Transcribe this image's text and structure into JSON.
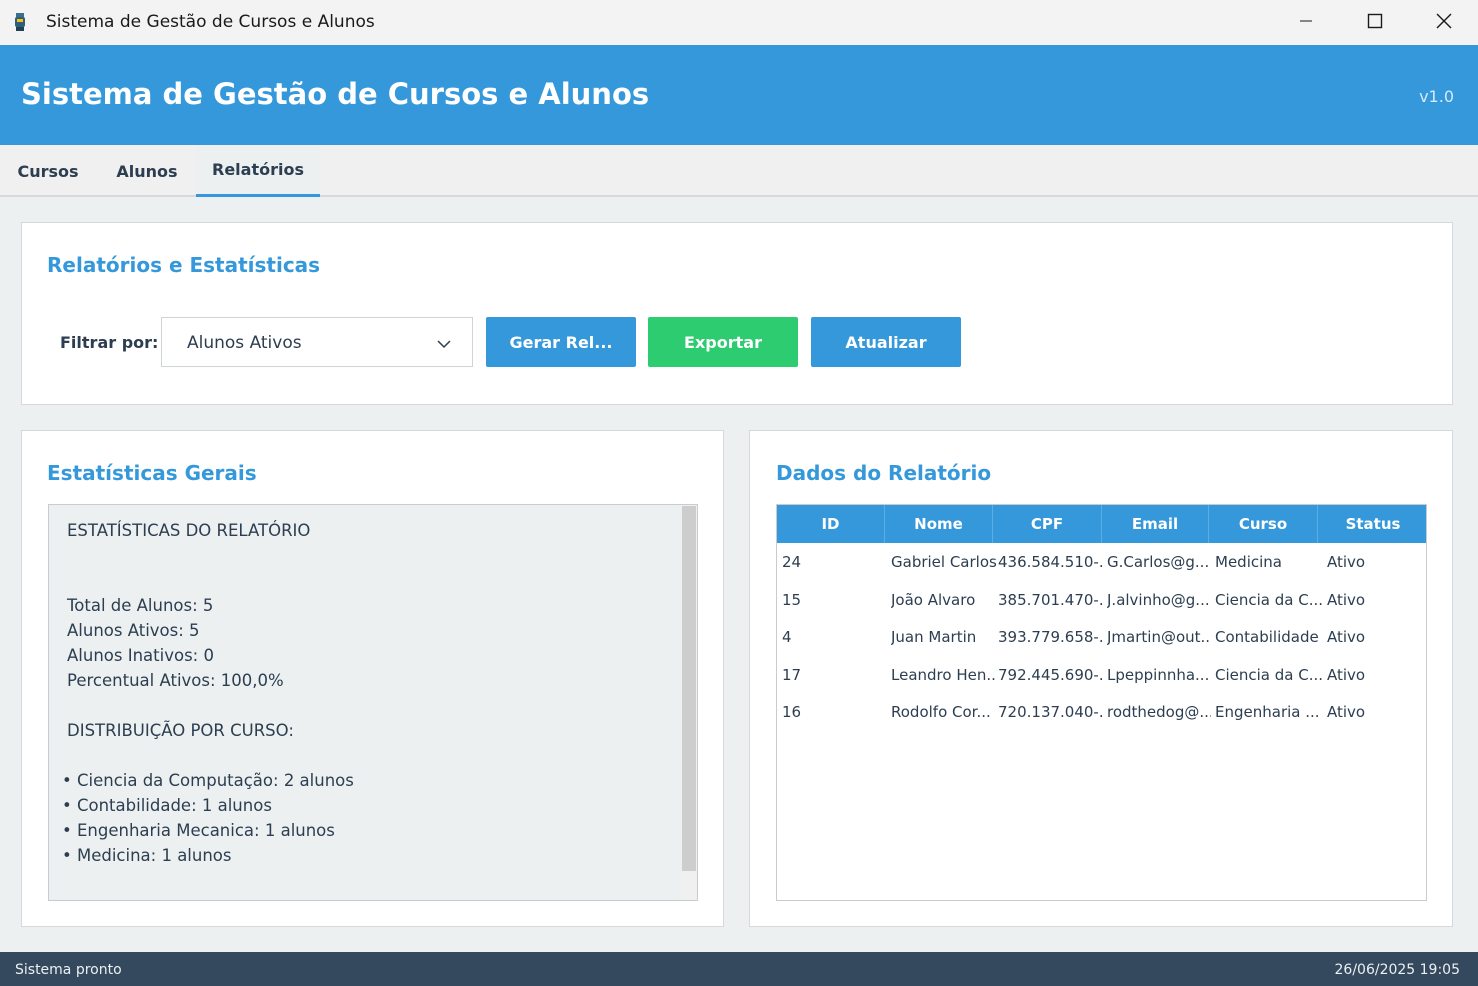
{
  "window": {
    "title": "Sistema de Gestão de Cursos e Alunos",
    "icon": "app-icon",
    "controls": [
      "minimize-icon",
      "maximize-icon",
      "close-icon"
    ]
  },
  "header": {
    "title": "Sistema de Gestão de Cursos e Alunos",
    "version": "v1.0",
    "color": "#3498db"
  },
  "tabs": [
    {
      "label": "Cursos",
      "active": false
    },
    {
      "label": "Alunos",
      "active": false
    },
    {
      "label": "Relatórios",
      "active": true
    }
  ],
  "reports": {
    "title": "Relatórios e Estatísticas",
    "filter_label": "Filtrar por:",
    "filter_value": "Alunos Ativos",
    "buttons": {
      "gerar": "Gerar Rel...",
      "exportar": "Exportar",
      "atualizar": "Atualizar"
    },
    "colors": {
      "primary": "#3498db",
      "success": "#2ecc71"
    }
  },
  "stats": {
    "title": "Estatísticas Gerais",
    "lines": [
      "ESTATÍSTICAS DO RELATÓRIO",
      "Total de Alunos: 5",
      "Alunos Ativos: 5",
      "Alunos Inativos: 0",
      "Percentual Ativos: 100,0%",
      "DISTRIBUIÇÃO POR CURSO:",
      "• Ciencia da Computação: 2 alunos",
      "• Contabilidade: 1 alunos",
      "• Engenharia Mecanica: 1 alunos",
      "• Medicina: 1 alunos"
    ]
  },
  "report_data": {
    "title": "Dados do Relatório",
    "columns": [
      "ID",
      "Nome",
      "CPF",
      "Email",
      "Curso",
      "Status"
    ],
    "rows": [
      [
        "24",
        "Gabriel Carlos",
        "436.584.510-...",
        "G.Carlos@g...",
        "Medicina",
        "Ativo"
      ],
      [
        "15",
        "João Alvaro",
        "385.701.470-...",
        "J.alvinho@g...",
        "Ciencia da C...",
        "Ativo"
      ],
      [
        "4",
        "Juan Martin",
        "393.779.658-...",
        "Jmartin@out...",
        "Contabilidade",
        "Ativo"
      ],
      [
        "17",
        "Leandro Hen...",
        "792.445.690-...",
        "Lpeppinnha...",
        "Ciencia da C...",
        "Ativo"
      ],
      [
        "16",
        "Rodolfo Cor...",
        "720.137.040-...",
        "rodthedog@...",
        "Engenharia ...",
        "Ativo"
      ]
    ]
  },
  "statusbar": {
    "message": "Sistema pronto",
    "datetime": "26/06/2025 19:05",
    "color": "#34495e"
  }
}
